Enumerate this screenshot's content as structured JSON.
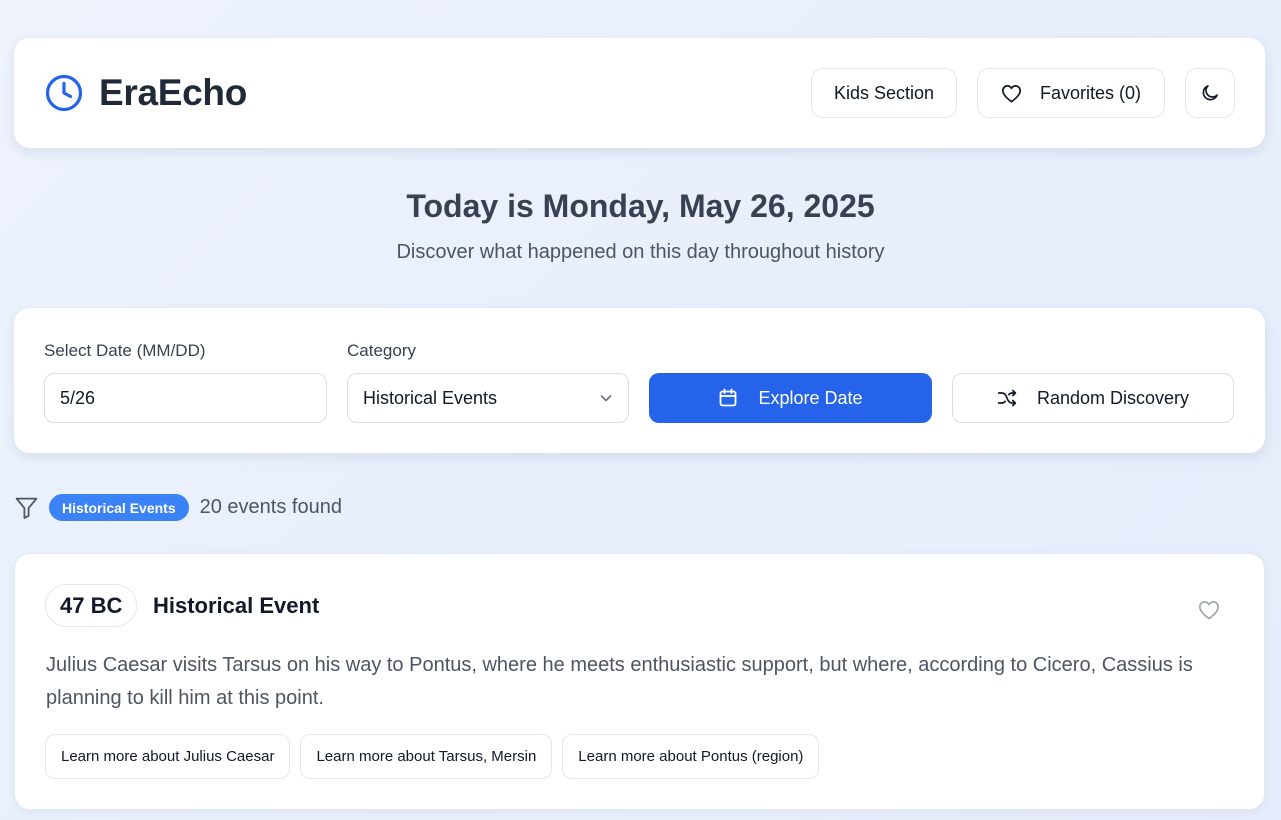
{
  "app": {
    "name": "EraEcho"
  },
  "header": {
    "kids_label": "Kids Section",
    "favorites_label": "Favorites (0)"
  },
  "hero": {
    "title": "Today is Monday, May 26, 2025",
    "subtitle": "Discover what happened on this day throughout history"
  },
  "controls": {
    "date_label": "Select Date (MM/DD)",
    "date_value": "5/26",
    "category_label": "Category",
    "category_value": "Historical Events",
    "explore_label": "Explore Date",
    "random_label": "Random Discovery"
  },
  "filter": {
    "active_category": "Historical Events",
    "count_text": "20 events found"
  },
  "events": [
    {
      "year": "47 BC",
      "type": "Historical Event",
      "description": "Julius Caesar visits Tarsus on his way to Pontus, where he meets enthusiastic support, but where, according to Cicero, Cassius is planning to kill him at this point.",
      "links": [
        "Learn more about Julius Caesar",
        "Learn more about Tarsus, Mersin",
        "Learn more about Pontus (region)"
      ]
    }
  ],
  "colors": {
    "accent": "#2563eb",
    "pill": "#3b82f6"
  },
  "icons": [
    "clock-icon",
    "heart-icon",
    "moon-icon",
    "calendar-icon",
    "shuffle-icon",
    "filter-icon",
    "chevron-down-icon"
  ]
}
